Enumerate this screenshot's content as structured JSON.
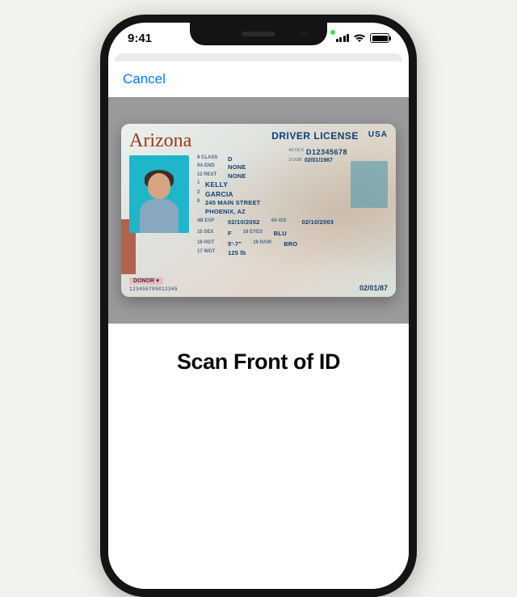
{
  "status": {
    "time": "9:41"
  },
  "sheet": {
    "cancel_label": "Cancel",
    "instruction": "Scan Front of ID"
  },
  "id_card": {
    "state": "Arizona",
    "doc_type": "DRIVER LICENSE",
    "country": "USA",
    "class_label": "9 CLASS",
    "class_val": "D",
    "end_label": "9a END",
    "end_val": "NONE",
    "rest_label": "12 REST",
    "rest_val": "NONE",
    "dln_label": "4d DLN",
    "dln_val": "D12345678",
    "dob_label": "3  DOB",
    "dob_val": "02/01/1987",
    "surname": "KELLY",
    "given": "GARCIA",
    "addr1": "245 MAIN STREET",
    "addr2": "PHOENIX, AZ",
    "exp_label": "4b EXP",
    "exp_val": "02/10/2052",
    "iss_label": "4a ISS",
    "iss_val": "02/10/2003",
    "sex_label": "15 SEX",
    "sex_val": "F",
    "eyes_label": "18 EYES",
    "eyes_val": "BLU",
    "hgt_label": "16 HGT",
    "hgt_val": "5'-7\"",
    "hair_label": "19 HAIR",
    "hair_val": "BRO",
    "wgt_label": "17 WGT",
    "wgt_val": "125 lb",
    "donor": "DONOR ♥",
    "barcode": "123456789012345",
    "dob_big": "02/01/87"
  }
}
